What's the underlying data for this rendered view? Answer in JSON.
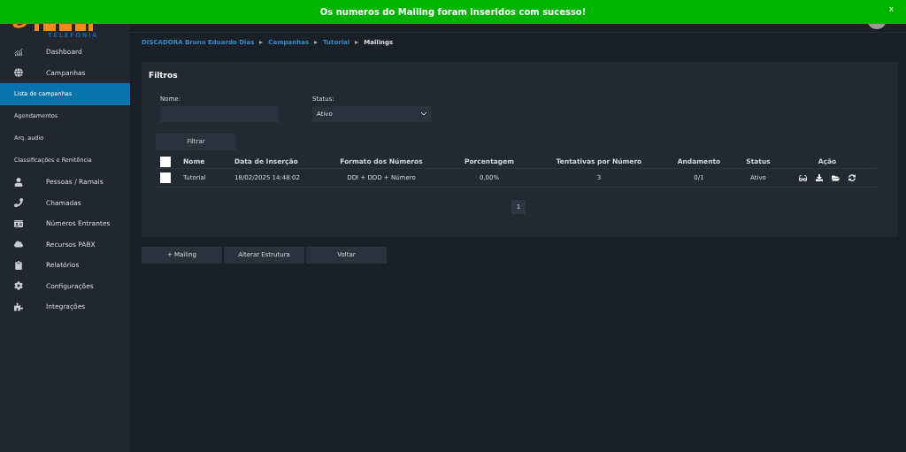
{
  "banner": {
    "message": "Os numeros do Mailing foram inseridos com sucesso!",
    "close": "x"
  },
  "logo": {
    "tagline": "TELEFONIA"
  },
  "sidebar": {
    "items": [
      {
        "label": "Dashboard",
        "kind": "main",
        "selected": false
      },
      {
        "label": "Campanhas",
        "kind": "main",
        "selected": false
      },
      {
        "label": "Lista de campanhas",
        "kind": "sub",
        "selected": true
      },
      {
        "label": "Agendamentos",
        "kind": "sub",
        "selected": false
      },
      {
        "label": "Arq. audio",
        "kind": "sub",
        "selected": false
      },
      {
        "label": "Classificações e Renitência",
        "kind": "sub",
        "selected": false
      },
      {
        "label": "Pessoas / Ramais",
        "kind": "main",
        "selected": false
      },
      {
        "label": "Chamadas",
        "kind": "main",
        "selected": false
      },
      {
        "label": "Números Entrantes",
        "kind": "main",
        "selected": false
      },
      {
        "label": "Recursos PABX",
        "kind": "main",
        "selected": false
      },
      {
        "label": "Relatórios",
        "kind": "main",
        "selected": false
      },
      {
        "label": "Configurações",
        "kind": "main",
        "selected": false
      },
      {
        "label": "Integrações",
        "kind": "main",
        "selected": false
      }
    ]
  },
  "breadcrumb": [
    "DISCADORA Bruno Eduardo Dias",
    "Campanhas",
    "Tutorial",
    "Mailings"
  ],
  "filters": {
    "title": "Filtros",
    "name_label": "Nome:",
    "status_label": "Status:",
    "status_value": "Ativo",
    "button": "Filtrar"
  },
  "table": {
    "columns": [
      "Nome",
      "Data de Inserção",
      "Formato dos Números",
      "Porcentagem",
      "Tentativas por Número",
      "Andamento",
      "Status",
      "Ação"
    ],
    "header_checked": false,
    "rows": [
      {
        "checked": false,
        "cells": [
          "Tutorial",
          "18/02/2025 14:48:02",
          "DDI + DDD + Número",
          "0,00%",
          "3",
          "0/1",
          "Ativo"
        ]
      }
    ]
  },
  "pagination": [
    {
      "label": "1",
      "selected": true
    }
  ],
  "buttons": [
    "+ Mailing",
    "Alterar Estrutura",
    "Voltar"
  ]
}
